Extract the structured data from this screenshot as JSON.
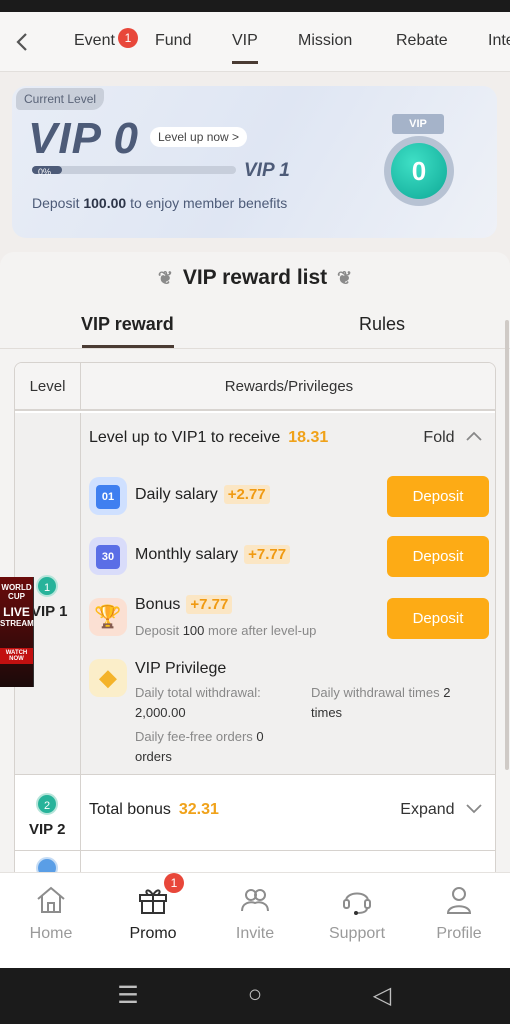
{
  "nav": {
    "back_icon": "chevron-left-icon",
    "tabs": [
      {
        "label": "Event",
        "badge": "1"
      },
      {
        "label": "Fund"
      },
      {
        "label": "VIP",
        "active": true
      },
      {
        "label": "Mission"
      },
      {
        "label": "Rebate"
      },
      {
        "label": "Inte"
      }
    ]
  },
  "level_card": {
    "tag": "Current Level",
    "vip": "VIP 0",
    "levelup": "Level up now >",
    "progress_text": "0%",
    "progress_value": 0,
    "next_level": "VIP 1",
    "deposit_prefix": "Deposit",
    "deposit_amount": "100.00",
    "deposit_suffix": "to enjoy member benefits",
    "medal_ribbon": "VIP",
    "medal_level": "0"
  },
  "reward_list": {
    "title": "VIP reward list",
    "subtabs": [
      "VIP reward",
      "Rules"
    ],
    "table": {
      "col_level": "Level",
      "col_rewards": "Rewards/Privileges",
      "vip1": {
        "badge": "1",
        "label": "VIP 1",
        "head": "Level up to VIP1 to receive",
        "amount": "18.31",
        "fold": "Fold",
        "items": [
          {
            "name": "Daily salary",
            "value": "+2.77",
            "icon_text": "01",
            "button": "Deposit"
          },
          {
            "name": "Monthly salary",
            "value": "+7.77",
            "icon_text": "30",
            "button": "Deposit"
          },
          {
            "name": "Bonus",
            "value": "+7.77",
            "sub_prefix": "Deposit",
            "sub_amount": "100",
            "sub_suffix": "more after level-up",
            "button": "Deposit"
          }
        ],
        "privilege": {
          "title": "VIP Privilege",
          "withdrawal_label": "Daily total withdrawal:",
          "withdrawal_value": "2,000.00",
          "withdraw_times_label": "Daily withdrawal times",
          "withdraw_times_value": "2",
          "withdraw_times_suffix": "times",
          "fee_free_label": "Daily fee-free orders",
          "fee_free_value": "0",
          "fee_free_suffix": "orders"
        }
      },
      "vip2": {
        "badge": "2",
        "label": "VIP 2",
        "head": "Total bonus",
        "amount": "32.31",
        "expand": "Expand"
      }
    }
  },
  "ad": {
    "line1": "WORLD",
    "line2": "CUP",
    "line3": "LIVE",
    "line4": "STREAM",
    "watch": "WATCH NOW"
  },
  "bottom_nav": [
    {
      "label": "Home",
      "icon": "home-icon"
    },
    {
      "label": "Promo",
      "icon": "gift-icon",
      "badge": "1",
      "active": true
    },
    {
      "label": "Invite",
      "icon": "invite-icon"
    },
    {
      "label": "Support",
      "icon": "headset-icon"
    },
    {
      "label": "Profile",
      "icon": "profile-icon"
    }
  ]
}
